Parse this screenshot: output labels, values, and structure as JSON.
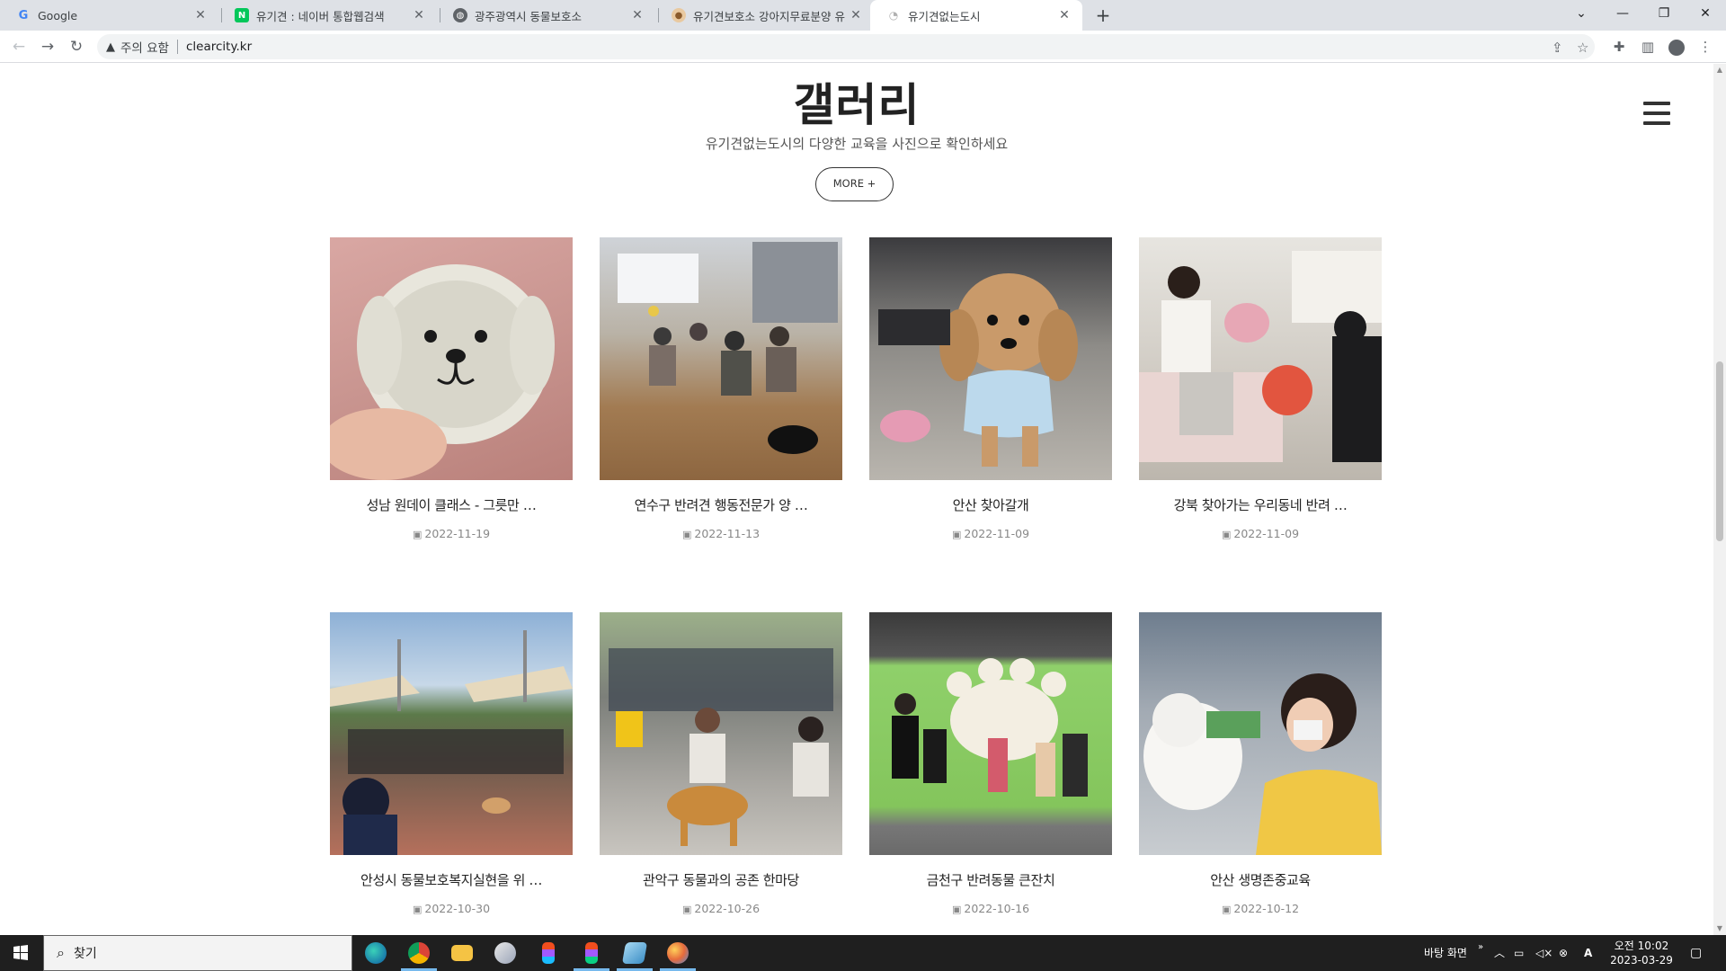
{
  "browser": {
    "tabs": [
      {
        "title": "Google",
        "favicon": "google-favicon"
      },
      {
        "title": "유기견 : 네이버 통합웹검색",
        "favicon": "naver-favicon"
      },
      {
        "title": "광주광역시 동물보호소",
        "favicon": "globe-favicon"
      },
      {
        "title": "유기견보호소 강아지무료분양 유",
        "favicon": "dog-favicon"
      },
      {
        "title": "유기견없는도시",
        "favicon": "site-favicon"
      }
    ],
    "active_tab": 4,
    "omnibox": {
      "security_label": "주의 요함",
      "url": "clearcity.kr"
    }
  },
  "page": {
    "section_title": "갤러리",
    "section_subtitle": "유기견없는도시의 다양한 교육을 사진으로 확인하세요",
    "more_label": "MORE +",
    "gallery": [
      {
        "caption": "성남 원데이 클래스 - 그릇만 …",
        "date": "2022-11-19"
      },
      {
        "caption": "연수구 반려견 행동전문가 양 …",
        "date": "2022-11-13"
      },
      {
        "caption": "안산 찾아갈개",
        "date": "2022-11-09"
      },
      {
        "caption": "강북 찾아가는 우리동네 반려 …",
        "date": "2022-11-09"
      },
      {
        "caption": "안성시 동물보호복지실현을 위 …",
        "date": "2022-10-30"
      },
      {
        "caption": "관악구 동물과의 공존 한마당",
        "date": "2022-10-26"
      },
      {
        "caption": "금천구 반려동물 큰잔치",
        "date": "2022-10-16"
      },
      {
        "caption": "안산 생명존중교육",
        "date": "2022-10-12"
      }
    ]
  },
  "taskbar": {
    "search_placeholder": "찾기",
    "desktop_label": "바탕 화면",
    "ime_label": "A",
    "time": "오전 10:02",
    "date": "2023-03-29"
  },
  "colors": {
    "tabbar_bg": "#dee1e6",
    "taskbar_bg": "#1f1f1f",
    "naver_green": "#03c75a",
    "text_dark": "#222222",
    "date_gray": "#888888"
  }
}
